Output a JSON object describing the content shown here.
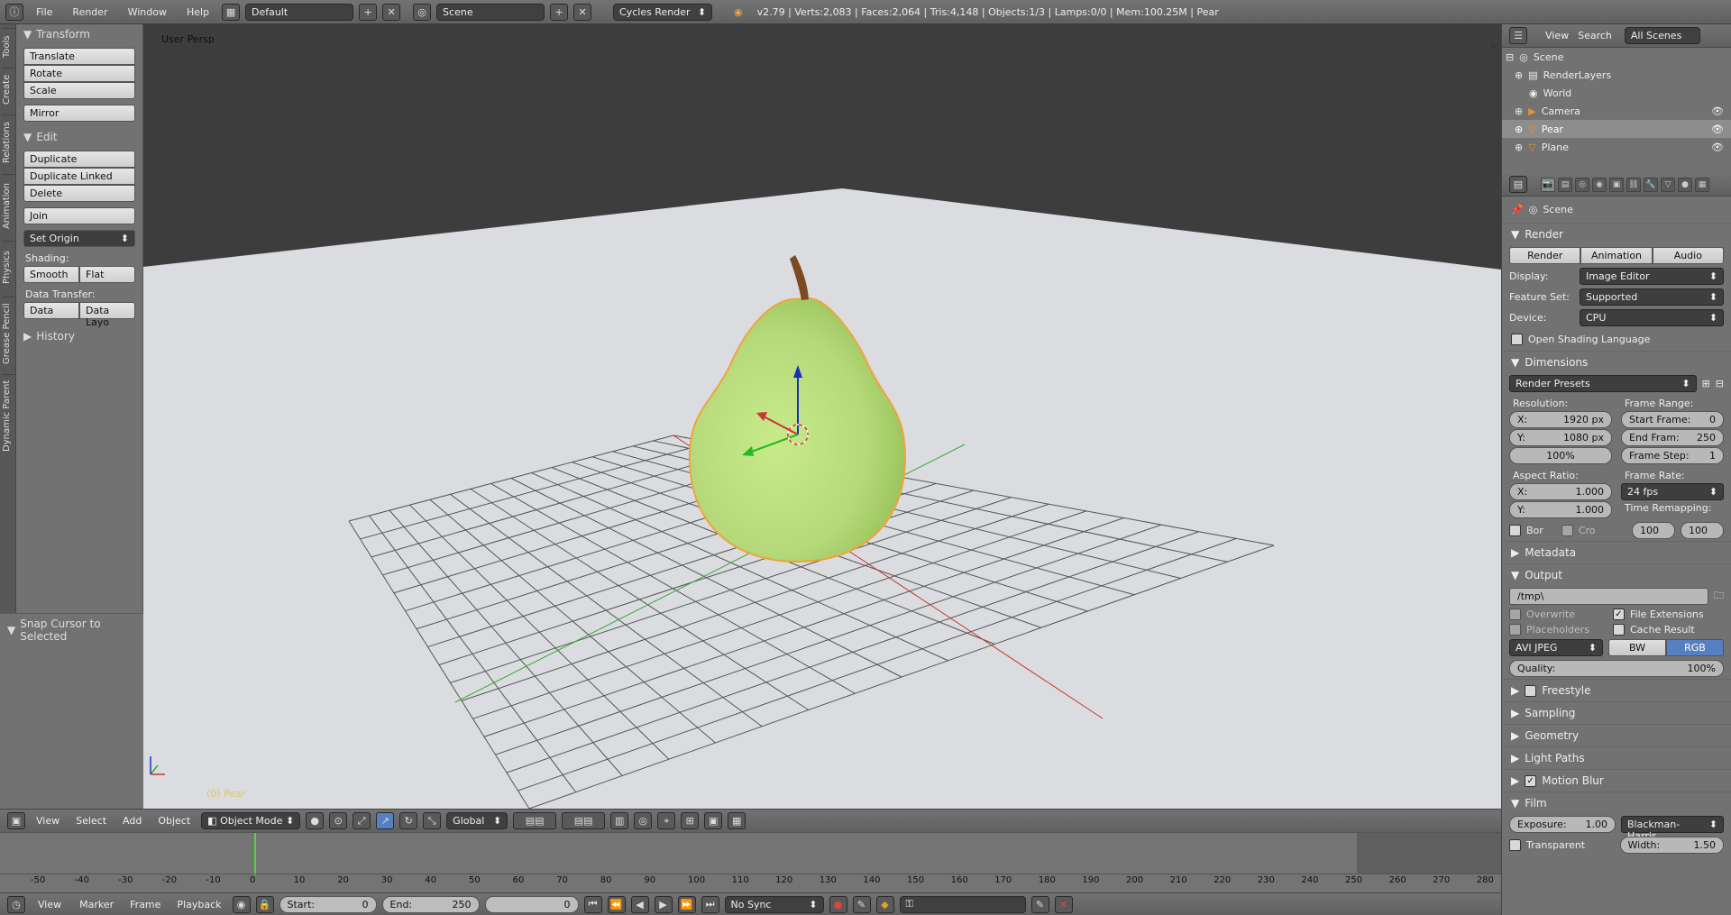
{
  "topbar": {
    "menus": [
      "File",
      "Render",
      "Window",
      "Help"
    ],
    "layout": "Default",
    "scene": "Scene",
    "engine": "Cycles Render",
    "stats": "v2.79 | Verts:2,083 | Faces:2,064 | Tris:4,148 | Objects:1/3 | Lamps:0/0 | Mem:100.25M | Pear"
  },
  "toolshelf": {
    "tabs": [
      "Tools",
      "Create",
      "Relations",
      "Animation",
      "Physics",
      "Grease Pencil",
      "Dynamic Parent"
    ],
    "transform_title": "Transform",
    "translate": "Translate",
    "rotate": "Rotate",
    "scale": "Scale",
    "mirror": "Mirror",
    "edit_title": "Edit",
    "duplicate": "Duplicate",
    "duplicate_linked": "Duplicate Linked",
    "delete": "Delete",
    "join": "Join",
    "set_origin": "Set Origin",
    "shading_label": "Shading:",
    "smooth": "Smooth",
    "flat": "Flat",
    "data_transfer_label": "Data Transfer:",
    "data": "Data",
    "data_layo": "Data Layo",
    "history_title": "History",
    "snap_title": "Snap Cursor to Selected"
  },
  "viewport": {
    "title": "User Persp",
    "object_label": "(0) Pear",
    "colors": {
      "bg_top": "#3d3d3d",
      "floor": "#dadce0",
      "pear": "#b9e07e",
      "selection": "#f2a33a"
    }
  },
  "vp_header": {
    "view": "View",
    "select": "Select",
    "add": "Add",
    "object": "Object",
    "mode": "Object Mode",
    "orientation": "Global"
  },
  "timeline": {
    "ticks": [
      "-50",
      "-40",
      "-30",
      "-20",
      "-10",
      "0",
      "10",
      "20",
      "30",
      "40",
      "50",
      "60",
      "70",
      "80",
      "90",
      "100",
      "110",
      "120",
      "130",
      "140",
      "150",
      "160",
      "170",
      "180",
      "190",
      "200",
      "210",
      "220",
      "230",
      "240",
      "250",
      "260",
      "270",
      "280"
    ],
    "current_frame": 0
  },
  "tl_header": {
    "view": "View",
    "marker": "Marker",
    "frame": "Frame",
    "playback": "Playback",
    "start_label": "Start:",
    "start_val": "0",
    "end_label": "End:",
    "end_val": "250",
    "current": "0",
    "sync": "No Sync"
  },
  "outliner": {
    "view": "View",
    "search": "Search",
    "scope": "All Scenes",
    "rows": [
      {
        "name": "Scene",
        "icon": "scene-icon"
      },
      {
        "name": "RenderLayers",
        "icon": "renderlayers-icon"
      },
      {
        "name": "World",
        "icon": "world-icon"
      },
      {
        "name": "Camera",
        "icon": "camera-icon"
      },
      {
        "name": "Pear",
        "icon": "mesh-icon"
      },
      {
        "name": "Plane",
        "icon": "mesh-icon"
      }
    ]
  },
  "props": {
    "context": "Scene",
    "render_title": "Render",
    "render_btn": "Render",
    "animation_btn": "Animation",
    "audio_btn": "Audio",
    "display_label": "Display:",
    "display_val": "Image Editor",
    "feature_label": "Feature Set:",
    "feature_val": "Supported",
    "device_label": "Device:",
    "device_val": "CPU",
    "osl": "Open Shading Language",
    "dimensions_title": "Dimensions",
    "render_presets": "Render Presets",
    "resolution_label": "Resolution:",
    "res_x_label": "X:",
    "res_x": "1920 px",
    "res_y_label": "Y:",
    "res_y": "1080 px",
    "res_pct": "100%",
    "frame_range_label": "Frame Range:",
    "start_frame_label": "Start Frame:",
    "start_frame": "0",
    "end_frame_label": "End Fram:",
    "end_frame": "250",
    "frame_step_label": "Frame Step:",
    "frame_step": "1",
    "aspect_label": "Aspect Ratio:",
    "asp_x": "1.000",
    "asp_y": "1.000",
    "frame_rate_label": "Frame Rate:",
    "fps": "24 fps",
    "time_remap_label": "Time Remapping:",
    "remap_a": "100",
    "remap_b": "100",
    "bor": "Bor",
    "cro": "Cro",
    "metadata_title": "Metadata",
    "output_title": "Output",
    "output_path": "/tmp\\",
    "overwrite": "Overwrite",
    "file_ext": "File Extensions",
    "placeholders": "Placeholders",
    "cache_result": "Cache Result",
    "format": "AVI JPEG",
    "bw": "BW",
    "rgb": "RGB",
    "quality_label": "Quality:",
    "quality_val": "100%",
    "freestyle": "Freestyle",
    "sampling": "Sampling",
    "geometry": "Geometry",
    "light_paths": "Light Paths",
    "motion_blur": "Motion Blur",
    "film_title": "Film",
    "exposure_label": "Exposure:",
    "exposure_val": "1.00",
    "filter": "Blackman-Harris",
    "transparent": "Transparent",
    "width_label": "Width:",
    "width_val": "1.50"
  }
}
